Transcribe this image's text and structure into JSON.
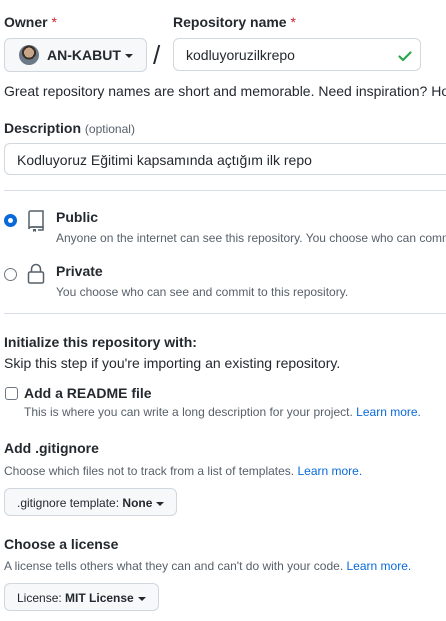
{
  "owner": {
    "label": "Owner",
    "required_mark": "*",
    "value": "AN-KABUT"
  },
  "separator": "/",
  "repo_name": {
    "label": "Repository name",
    "required_mark": "*",
    "value": "kodluyoruzilkrepo"
  },
  "name_hint": "Great repository names are short and memorable. Need inspiration? How",
  "description": {
    "label": "Description",
    "optional": "(optional)",
    "value": "Kodluyoruz Eğitimi kapsamında açtığım ilk repo"
  },
  "visibility": {
    "public": {
      "label": "Public",
      "desc": "Anyone on the internet can see this repository. You choose who can commi",
      "selected": true
    },
    "private": {
      "label": "Private",
      "desc": "You choose who can see and commit to this repository.",
      "selected": false
    }
  },
  "initialize": {
    "title": "Initialize this repository with:",
    "subtitle": "Skip this step if you're importing an existing repository.",
    "readme_label": "Add a README file",
    "readme_desc": "This is where you can write a long description for your project.",
    "readme_link": "Learn more."
  },
  "gitignore": {
    "title": "Add .gitignore",
    "desc": "Choose which files not to track from a list of templates.",
    "link": "Learn more.",
    "button_prefix": ".gitignore template:",
    "button_value": "None"
  },
  "license": {
    "title": "Choose a license",
    "desc": "A license tells others what they can and can't do with your code.",
    "link": "Learn more.",
    "button_prefix": "License:",
    "button_value": "MIT License"
  },
  "colors": {
    "accent": "#0969da",
    "success": "#2da44e",
    "danger": "#cf222e"
  }
}
